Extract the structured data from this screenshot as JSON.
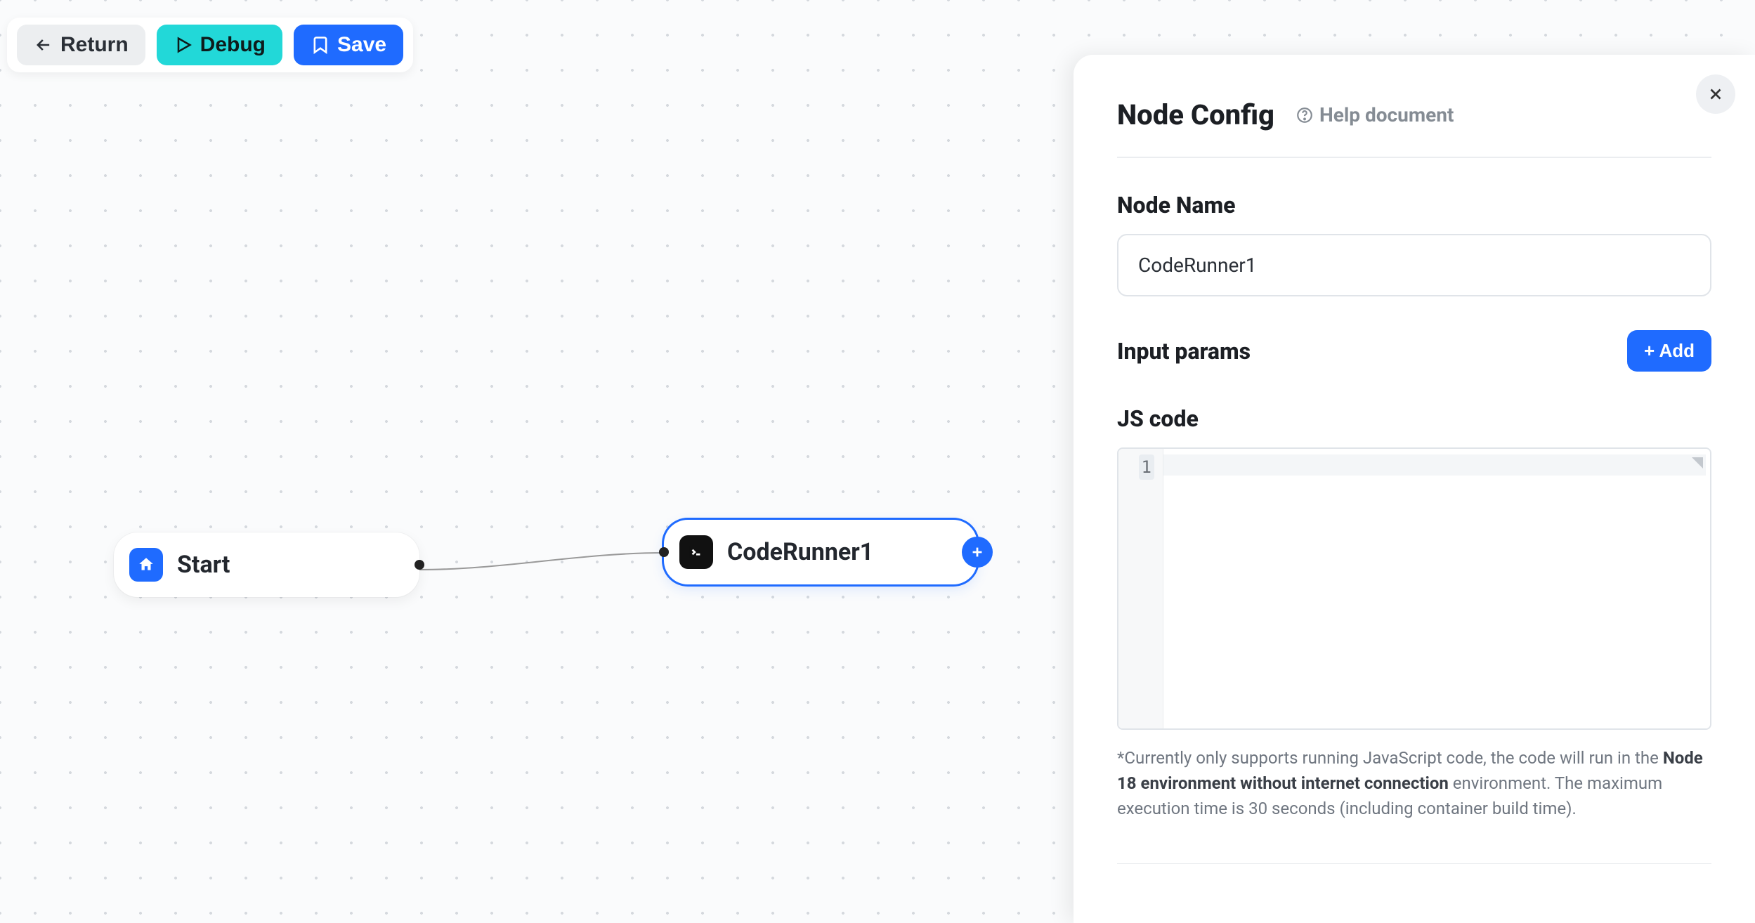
{
  "toolbar": {
    "return_label": "Return",
    "debug_label": "Debug",
    "save_label": "Save"
  },
  "canvas": {
    "nodes": {
      "start": {
        "label": "Start"
      },
      "coderunner": {
        "label": "CodeRunner1"
      }
    }
  },
  "panel": {
    "title": "Node Config",
    "help_label": "Help document",
    "node_name_label": "Node Name",
    "node_name_value": "CodeRunner1",
    "input_params_label": "Input params",
    "add_button_label": "+ Add",
    "js_code_label": "JS code",
    "code_line_number": "1",
    "hint_prefix": "*Currently only supports running JavaScript code, the code will run in the ",
    "hint_bold": "Node 18 environment without internet connection",
    "hint_suffix": " environment. The maximum execution time is 30 seconds (including container build time)."
  }
}
